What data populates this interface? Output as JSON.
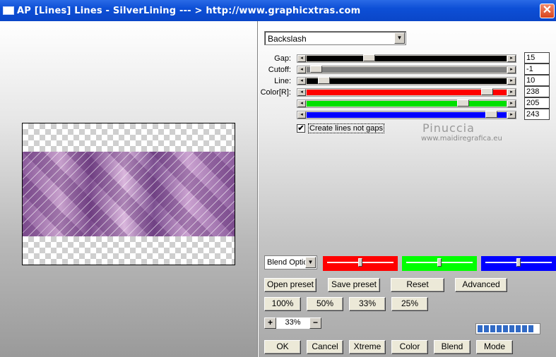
{
  "window": {
    "title": "AP [Lines]  Lines - SilverLining     --- > http://www.graphicxtras.com",
    "close_glyph": "✕"
  },
  "preset": {
    "value": "Backslash"
  },
  "sliders": [
    {
      "label": "Gap:",
      "value": "15",
      "fill_color": "#000000",
      "position": 0.3
    },
    {
      "label": "Cutoff:",
      "value": "-1",
      "fill_color": "#808080",
      "position": 0.02
    },
    {
      "label": "Line:",
      "value": "10",
      "fill_color": "#000000",
      "position": 0.06
    },
    {
      "label": "Color[R]:",
      "value": "238",
      "fill_color": "#ff0000",
      "position": 0.93
    },
    {
      "label": "",
      "value": "205",
      "fill_color": "#00e000",
      "position": 0.8
    },
    {
      "label": "",
      "value": "243",
      "fill_color": "#0000ff",
      "position": 0.95
    }
  ],
  "checkbox": {
    "label": "Create lines not gaps",
    "checked": true,
    "mark": "✔"
  },
  "watermark": {
    "line1": "Pinuccia",
    "line2": "www.maidiregrafica.eu"
  },
  "blend": {
    "value": "Blend Optio"
  },
  "color_swatches": [
    {
      "name": "red",
      "color": "#ff0000",
      "position": 0.5
    },
    {
      "name": "green",
      "color": "#00ff00",
      "position": 0.5
    },
    {
      "name": "blue",
      "color": "#0000ff",
      "position": 0.5
    }
  ],
  "buttons": {
    "open_preset": "Open preset",
    "save_preset": "Save preset",
    "reset": "Reset",
    "advanced": "Advanced",
    "zoom100": "100%",
    "zoom50": "50%",
    "zoom33": "33%",
    "zoom25": "25%",
    "ok": "OK",
    "cancel": "Cancel",
    "xtreme": "Xtreme",
    "color": "Color",
    "blend": "Blend",
    "mode": "Mode"
  },
  "zoom": {
    "plus": "+",
    "value": "33%",
    "minus": "−"
  },
  "progress": {
    "segments": 9
  }
}
